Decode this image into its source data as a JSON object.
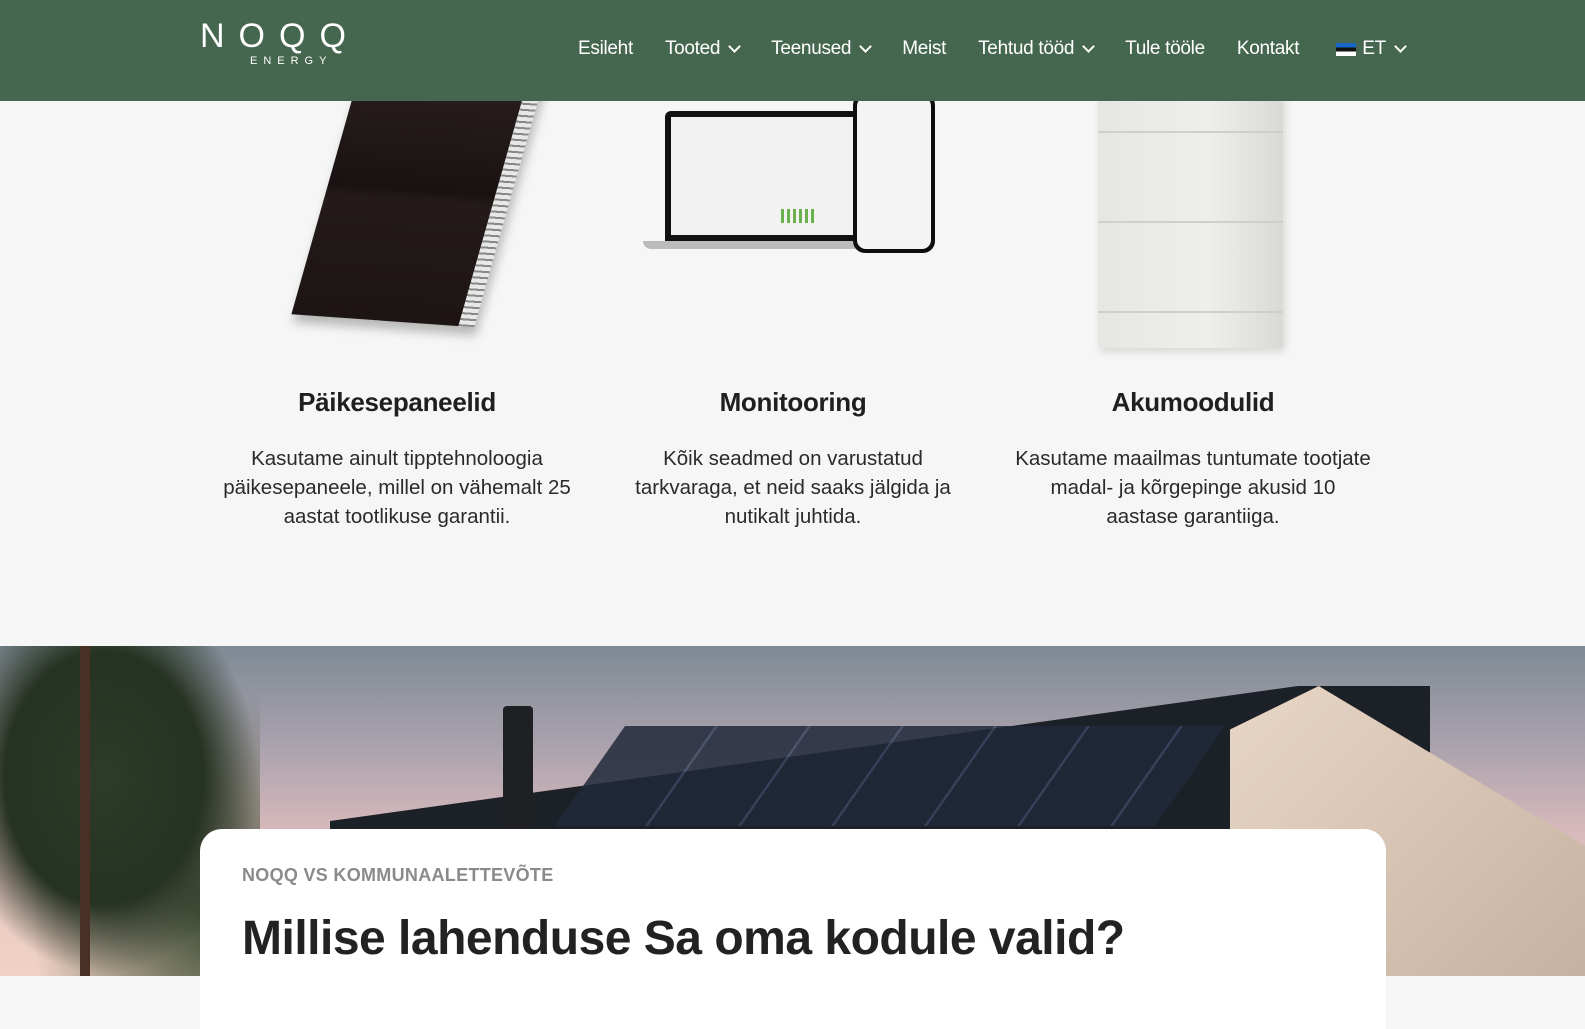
{
  "brand": {
    "logo_main": "NOQQ",
    "logo_sub": "ENERGY",
    "header_color": "#46674f"
  },
  "nav": {
    "items": [
      {
        "label": "Esileht",
        "has_dropdown": false
      },
      {
        "label": "Tooted",
        "has_dropdown": true
      },
      {
        "label": "Teenused",
        "has_dropdown": true
      },
      {
        "label": "Meist",
        "has_dropdown": false
      },
      {
        "label": "Tehtud tööd",
        "has_dropdown": true
      },
      {
        "label": "Tule tööle",
        "has_dropdown": false
      },
      {
        "label": "Kontakt",
        "has_dropdown": false
      }
    ],
    "language": {
      "label": "ET",
      "icon": "estonia-flag-icon"
    }
  },
  "products": [
    {
      "title": "Päikesepaneelid",
      "description": "Kasutame ainult tipptehnoloogia päikesepaneele, millel on vähemalt 25 aastat tootlikuse garantii.",
      "image": "solar-panel-image"
    },
    {
      "title": "Monitooring",
      "description": "Kõik seadmed on varustatud tarkvaraga, et neid saaks jälgida ja nutikalt juhtida.",
      "image": "monitoring-devices-image"
    },
    {
      "title": "Akumoodulid",
      "description": "Kasutame maailmas tuntumate tootjate madal- ja kõrgepinge akusid 10 aastase garantiiga.",
      "image": "battery-module-image"
    }
  ],
  "comparison_card": {
    "eyebrow": "NOQQ VS KOMMUNAALETTEVÕTE",
    "title": "Millise lahenduse Sa oma kodule valid?"
  }
}
